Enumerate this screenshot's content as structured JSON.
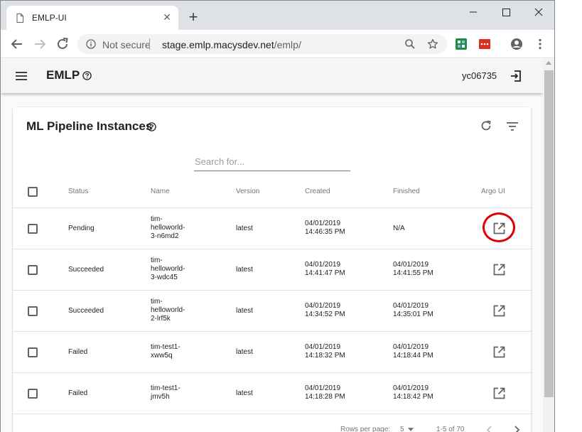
{
  "browser": {
    "tab_title": "EMLP-UI",
    "tab_close": "✕",
    "new_tab": "+",
    "security_label": "Not secure",
    "url_host": "stage.emlp.macysdev.net",
    "url_path": "/emlp/"
  },
  "app": {
    "title": "EMLP",
    "user": "yc06735"
  },
  "card": {
    "title": "ML Pipeline Instances",
    "search_placeholder": "Search for...",
    "columns": {
      "status": "Status",
      "name": "Name",
      "version": "Version",
      "created": "Created",
      "finished": "Finished",
      "argo": "Argo UI"
    },
    "rows": [
      {
        "status": "Pending",
        "name": [
          "tim-",
          "helloworld-",
          "3-n6md2"
        ],
        "version": "latest",
        "created": [
          "04/01/2019",
          "14:46:35 PM"
        ],
        "finished": [
          "N/A"
        ]
      },
      {
        "status": "Succeeded",
        "name": [
          "tim-",
          "helloworld-",
          "3-wdc45"
        ],
        "version": "latest",
        "created": [
          "04/01/2019",
          "14:41:47 PM"
        ],
        "finished": [
          "04/01/2019",
          "14:41:55 PM"
        ]
      },
      {
        "status": "Succeeded",
        "name": [
          "tim-",
          "helloworld-",
          "2-lrf5k"
        ],
        "version": "latest",
        "created": [
          "04/01/2019",
          "14:34:52 PM"
        ],
        "finished": [
          "04/01/2019",
          "14:35:01 PM"
        ]
      },
      {
        "status": "Failed",
        "name": [
          "tim-test1-",
          "xww5q"
        ],
        "version": "latest",
        "created": [
          "04/01/2019",
          "14:18:32 PM"
        ],
        "finished": [
          "04/01/2019",
          "14:18:44 PM"
        ]
      },
      {
        "status": "Failed",
        "name": [
          "tim-test1-",
          "jmv5h"
        ],
        "version": "latest",
        "created": [
          "04/01/2019",
          "14:18:28 PM"
        ],
        "finished": [
          "04/01/2019",
          "14:18:42 PM"
        ]
      }
    ],
    "footer": {
      "rows_per_page_label": "Rows per page:",
      "rows_per_page_value": "5",
      "range": "1-5 of 70"
    }
  },
  "colors": {
    "highlight": "#e00000",
    "tab_strip": "#dee1e6",
    "appbar": "#f5f5f5"
  }
}
